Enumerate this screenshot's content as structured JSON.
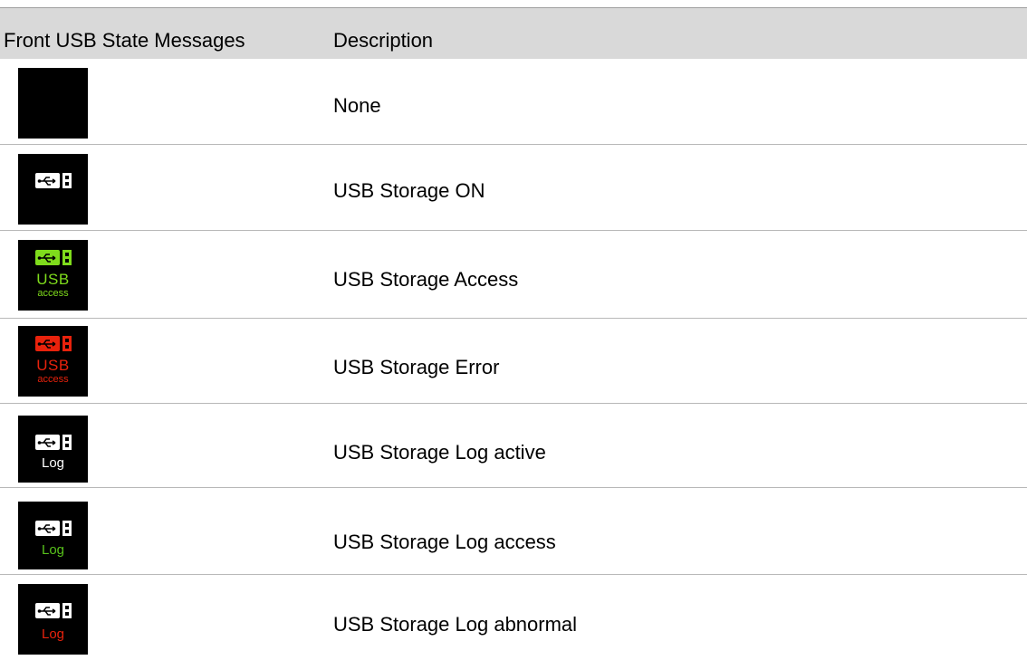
{
  "table": {
    "header": {
      "col1": "Front USB State Messages",
      "col2": "Description"
    },
    "rows": [
      {
        "description": "None",
        "icon": {
          "name": "blank-icon"
        }
      },
      {
        "description": "USB Storage ON",
        "icon": {
          "name": "usb-drive-icon",
          "color": "#ffffff"
        }
      },
      {
        "description": "USB Storage Access",
        "icon": {
          "name": "usb-drive-icon",
          "color": "#7fdc1c",
          "label": "USB",
          "sublabel": "access",
          "label_color": "#7fdc1c"
        }
      },
      {
        "description": "USB Storage Error",
        "icon": {
          "name": "usb-drive-icon",
          "color": "#e8220c",
          "label": "USB",
          "sublabel": "access",
          "label_color": "#e8220c"
        }
      },
      {
        "description": "USB Storage Log active",
        "icon": {
          "name": "usb-drive-icon",
          "color": "#ffffff",
          "label": "Log",
          "label_color": "#ffffff"
        }
      },
      {
        "description": "USB Storage Log access",
        "icon": {
          "name": "usb-drive-icon",
          "color": "#ffffff",
          "label": "Log",
          "label_color": "#58c21b"
        }
      },
      {
        "description": "USB Storage Log abnormal",
        "icon": {
          "name": "usb-drive-icon",
          "color": "#ffffff",
          "label": "Log",
          "label_color": "#e8220c"
        }
      }
    ]
  }
}
